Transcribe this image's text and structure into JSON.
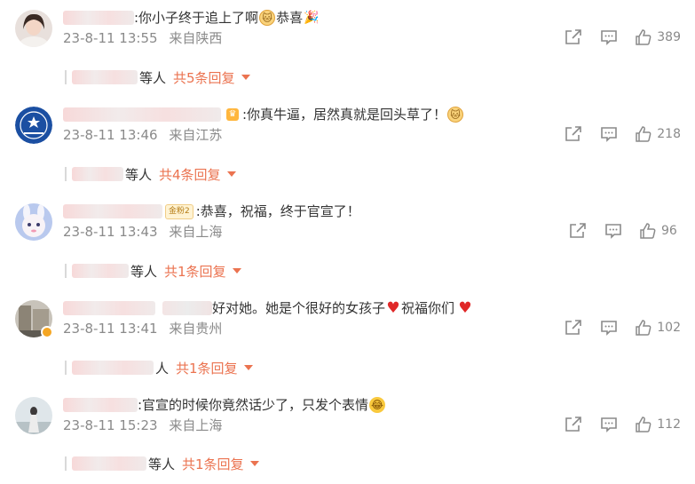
{
  "comments": [
    {
      "text": ":你小子终于追上了啊",
      "text_after": "恭喜",
      "emoji_1": "cat-emoji",
      "emoji_2": "party-popper-emoji",
      "date": "23-8-11 13:55",
      "location": "来自陕西",
      "likes": "389",
      "reply_others": "等人",
      "reply_count": "共5条回复"
    },
    {
      "text": ":你真牛逼，居然真就是回头草了！",
      "emoji_1": "crown-emoji",
      "emoji_2": "cat-emoji",
      "date": "23-8-11 13:46",
      "location": "来自江苏",
      "likes": "218",
      "reply_others": "等人",
      "reply_count": "共4条回复"
    },
    {
      "text": ":恭喜，祝福，终于官宣了！",
      "badge": "金粉2",
      "date": "23-8-11 13:43",
      "location": "来自上海",
      "likes": "96",
      "reply_others": "等人",
      "reply_count": "共1条回复"
    },
    {
      "text_pre": "好对她。她是个很好的女孩子",
      "text_mid": "祝福你们",
      "emoji_1": "red-heart-emoji",
      "emoji_2": "red-heart-emoji",
      "date": "23-8-11 13:41",
      "location": "来自贵州",
      "likes": "102",
      "reply_others": "人",
      "reply_count": "共1条回复"
    },
    {
      "text": ":官宣的时候你竟然话少了，只发个表情",
      "emoji_1": "laughing-tears-emoji",
      "date": "23-8-11 15:23",
      "location": "来自上海",
      "likes": "112",
      "reply_others": "等人",
      "reply_count": "共1条回复"
    }
  ],
  "glyphs": {
    "cat": "🐱",
    "crown": "♛",
    "party": "🎉",
    "heart": "♥",
    "laugh": "😂"
  },
  "colors": {
    "accent": "#eb7350",
    "meta": "#8a8a8a",
    "text": "#333333"
  }
}
